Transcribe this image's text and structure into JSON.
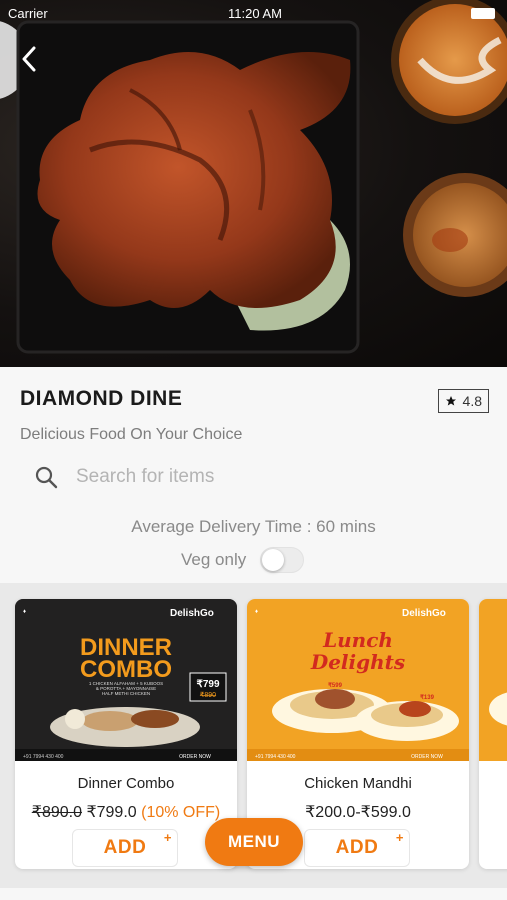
{
  "status_bar": {
    "carrier": "Carrier",
    "time": "11:20 AM"
  },
  "hero": {
    "back_icon": "chevron-left-icon",
    "image": "grilled-chicken-photo"
  },
  "restaurant": {
    "name": "DIAMOND DINE",
    "rating": "4.8",
    "rating_icon": "star-icon",
    "tagline": "Delicious Food On Your Choice"
  },
  "search": {
    "placeholder": "Search for items",
    "value": "",
    "icon": "search-icon"
  },
  "delivery_text": "Average Delivery Time : 60 mins",
  "veg_only": {
    "label": "Veg only",
    "enabled": false
  },
  "items": [
    {
      "name": "Dinner Combo",
      "price_original": "₹890.0",
      "price": "₹799.0",
      "discount": "(10% OFF)",
      "add_label": "ADD",
      "plus": "+",
      "banner": {
        "brand": "DelishGo",
        "headline_1": "DINNER",
        "headline_2": "COMBO",
        "desc_1": "1 CHICKEN ALFAHAM + 5 KUBOOS",
        "desc_2": "& POROTTA + MAYONNAISE",
        "desc_3": "HALF METHI CHICKEN",
        "price_new": "₹799",
        "price_old": "₹890",
        "order_now": "ORDER NOW",
        "phone": "+91 7994 430 400"
      }
    },
    {
      "name": "Chicken Mandhi",
      "price": "₹200.0-₹599.0",
      "add_label": "ADD",
      "plus": "+",
      "banner": {
        "brand": "DelishGo",
        "headline_1": "Lunch",
        "headline_2": "Delights",
        "price_a": "₹599",
        "price_b": "₹139",
        "order_now": "ORDER NOW",
        "phone": "+91 7994 430 400"
      }
    }
  ],
  "menu_button": {
    "label": "MENU"
  },
  "colors": {
    "accent": "#f07a12",
    "title": "#1b1b1b",
    "muted": "#8a8a8a"
  }
}
